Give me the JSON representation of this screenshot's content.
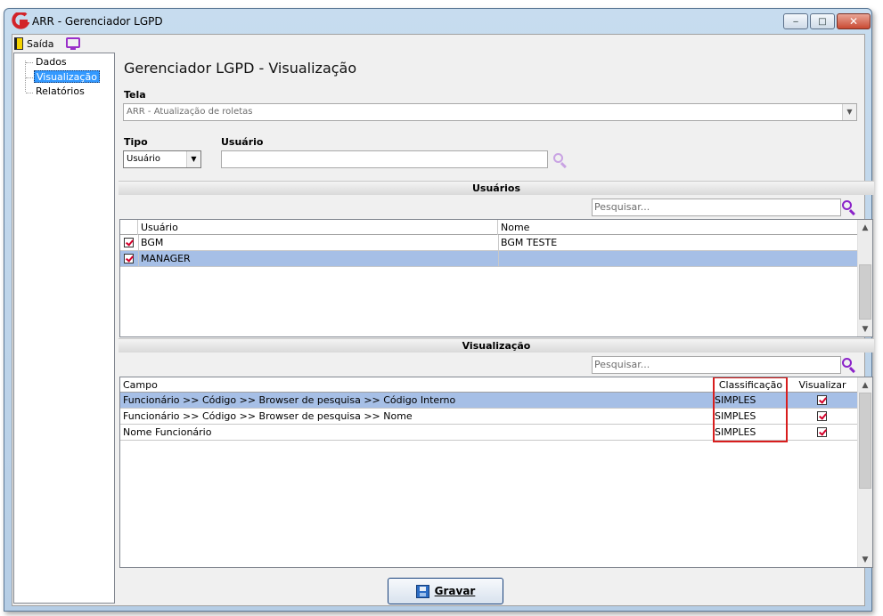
{
  "window": {
    "title": "ARR - Gerenciador LGPD",
    "controls": {
      "minimize": "‒",
      "maximize": "□",
      "close": "✕"
    }
  },
  "menubar": {
    "exit_label": "Saída"
  },
  "nav": {
    "items": [
      {
        "label": "Dados",
        "selected": false
      },
      {
        "label": "Visualização",
        "selected": true
      },
      {
        "label": "Relatórios",
        "selected": false
      }
    ]
  },
  "main": {
    "title": "Gerenciador LGPD - Visualização",
    "tela": {
      "label": "Tela",
      "value": "ARR - Atualização de roletas"
    },
    "tipo": {
      "label": "Tipo",
      "value": "Usuário"
    },
    "usuario": {
      "label": "Usuário",
      "value": ""
    }
  },
  "usuarios": {
    "section_title": "Usuários",
    "search_placeholder": "Pesquisar...",
    "columns": [
      "Usuário",
      "Nome"
    ],
    "rows": [
      {
        "checked": true,
        "usuario": "BGM",
        "nome": "BGM TESTE",
        "selected": false
      },
      {
        "checked": true,
        "usuario": "MANAGER",
        "nome": "",
        "selected": true
      }
    ]
  },
  "visualizacao": {
    "section_title": "Visualização",
    "search_placeholder": "Pesquisar...",
    "columns": [
      "Campo",
      "Classificação",
      "Visualizar"
    ],
    "rows": [
      {
        "campo": "Funcionário >> Código >> Browser de pesquisa >> Código Interno",
        "classificacao": "SIMPLES",
        "visualizar": true,
        "selected": true
      },
      {
        "campo": "Funcionário >> Código >> Browser de pesquisa >> Nome",
        "classificacao": "SIMPLES",
        "visualizar": true,
        "selected": false
      },
      {
        "campo": "Nome Funcionário",
        "classificacao": "SIMPLES",
        "visualizar": true,
        "selected": false
      }
    ]
  },
  "footer": {
    "save_label": "Gravar"
  },
  "colors": {
    "accent": "#8b23c9",
    "selection": "#a6bfe6",
    "highlight": "#d81e1e",
    "check": "#d4002a"
  }
}
